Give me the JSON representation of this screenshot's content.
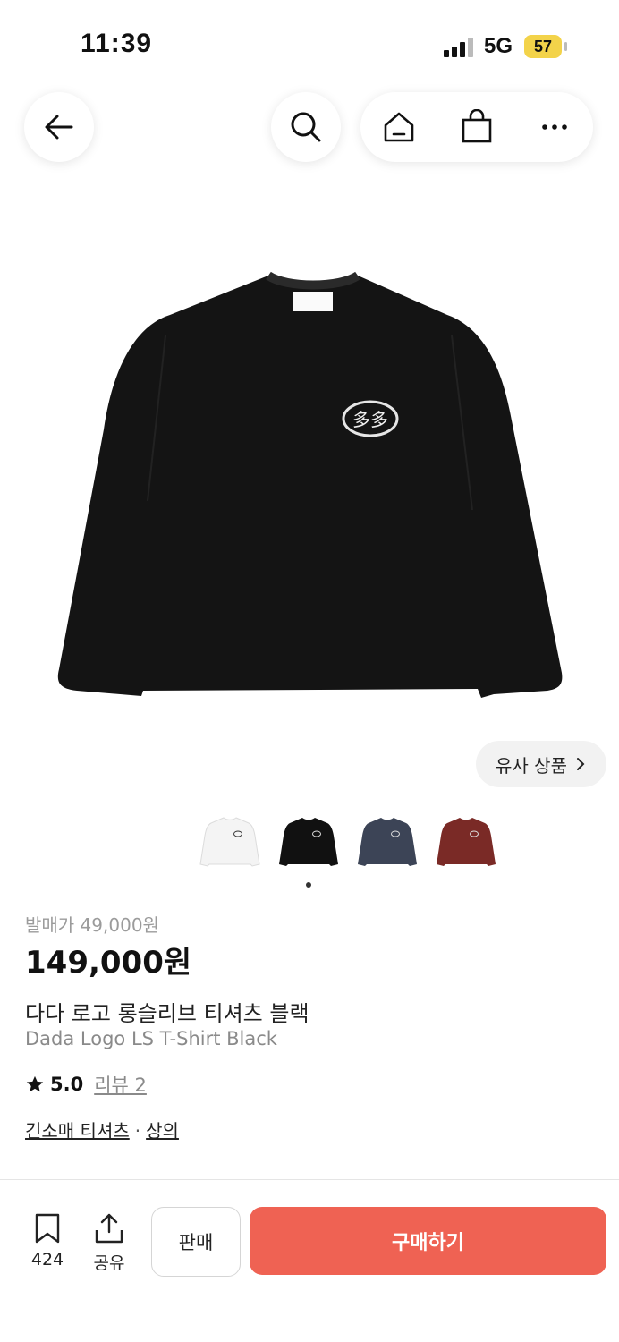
{
  "status": {
    "time": "11:39",
    "network": "5G",
    "battery": "57"
  },
  "nav": {
    "back_icon": "arrow-left-icon",
    "search_icon": "search-icon",
    "home_icon": "home-icon",
    "bag_icon": "shopping-bag-icon",
    "more_icon": "more-icon"
  },
  "product": {
    "similar_label": "유사 상품",
    "release_price": "발매가 49,000원",
    "price": "149,000원",
    "name_ko": "다다 로고 롱슬리브 티셔츠 블랙",
    "name_en": "Dada Logo LS T-Shirt Black",
    "rating": "5.0",
    "reviews": "리뷰 2",
    "category_1": "긴소매 티셔츠",
    "category_sep": "·",
    "category_2": "상의",
    "logo_text": "多多",
    "variants": [
      {
        "color": "#f4f4f4"
      },
      {
        "color": "#111111"
      },
      {
        "color": "#3c4456"
      },
      {
        "color": "#7a2a26"
      }
    ]
  },
  "bottom": {
    "bookmark_count": "424",
    "share_label": "공유",
    "sell_label": "판매",
    "buy_label": "구매하기"
  },
  "colors": {
    "accent": "#ef6253"
  }
}
